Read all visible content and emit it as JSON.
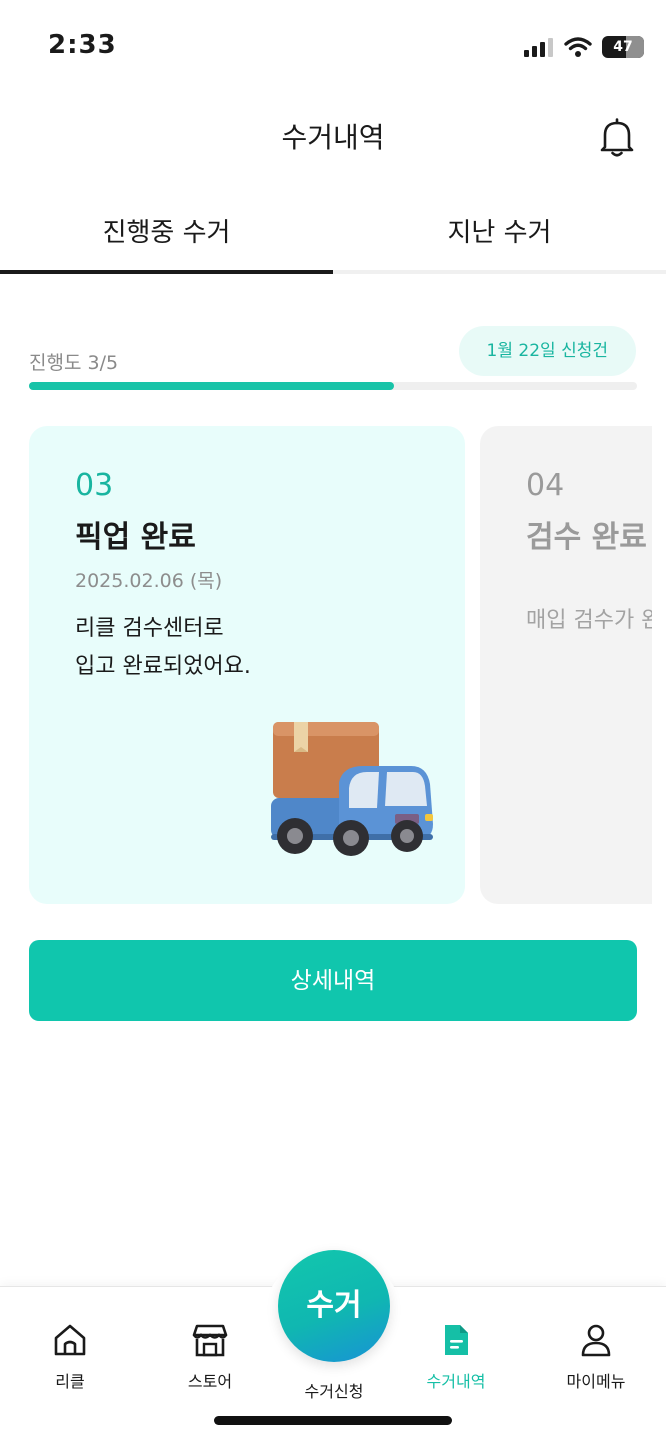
{
  "status_bar": {
    "time": "2:33",
    "battery": "47"
  },
  "header": {
    "title": "수거내역"
  },
  "tabs": [
    {
      "label": "진행중 수거",
      "active": true
    },
    {
      "label": "지난 수거",
      "active": false
    }
  ],
  "progress": {
    "label": "진행도 3/5",
    "current": 3,
    "total": 5,
    "date_chip": "1월 22일 신청건"
  },
  "cards": [
    {
      "number": "03",
      "title": "픽업 완료",
      "date": "2025.02.06 (목)",
      "description": "리클 검수센터로\n입고 완료되었어요."
    },
    {
      "number": "04",
      "title": "검수 완료",
      "description": "매입 검수가 완"
    }
  ],
  "detail_button": {
    "label": "상세내역"
  },
  "bottom_nav": {
    "items": [
      {
        "label": "리클",
        "icon": "home-icon"
      },
      {
        "label": "스토어",
        "icon": "store-icon"
      },
      {
        "label": "수거내역",
        "icon": "document-icon",
        "active": true
      },
      {
        "label": "마이메뉴",
        "icon": "person-icon"
      }
    ],
    "fab": {
      "label": "수거",
      "caption": "수거신청"
    }
  },
  "colors": {
    "accent": "#10c6ad",
    "card_bg": "#e8fdfb",
    "chip_bg": "#e8faf7"
  }
}
